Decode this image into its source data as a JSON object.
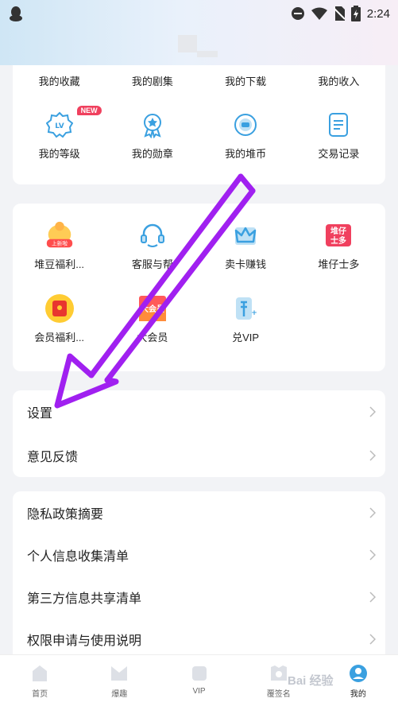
{
  "status_bar": {
    "time": "2:24"
  },
  "top_grid": {
    "row1": [
      "我的收藏",
      "我的剧集",
      "我的下载",
      "我的收入"
    ],
    "row2": [
      {
        "label": "我的等级",
        "icon": "level-icon",
        "badge": "NEW"
      },
      {
        "label": "我的勋章",
        "icon": "medal-icon"
      },
      {
        "label": "我的堆币",
        "icon": "coin-icon"
      },
      {
        "label": "交易记录",
        "icon": "record-icon"
      }
    ]
  },
  "services": {
    "row1": [
      {
        "label": "堆豆福利...",
        "icon": "gift-bag-icon",
        "icon_text": "上新啦"
      },
      {
        "label": "客服与帮",
        "icon": "headset-icon"
      },
      {
        "label": "卖卡赚钱",
        "icon": "crown-card-icon"
      },
      {
        "label": "堆仔士多",
        "icon": "store-icon",
        "icon_text": "堆仔士多"
      }
    ],
    "row2": [
      {
        "label": "会员福利...",
        "icon": "red-envelope-icon"
      },
      {
        "label": "大会员",
        "icon": "big-member-icon",
        "icon_text": "大会员"
      },
      {
        "label": "兑VIP",
        "icon": "vip-exchange-icon"
      }
    ]
  },
  "settings": [
    "设置",
    "意见反馈"
  ],
  "privacy": [
    "隐私政策摘要",
    "个人信息收集清单",
    "第三方信息共享清单",
    "权限申请与使用说明"
  ],
  "tabs": [
    {
      "label": "首页",
      "icon": "home-icon"
    },
    {
      "label": "爆趣",
      "icon": "explore-icon"
    },
    {
      "label": "VIP",
      "icon": "vip-icon"
    },
    {
      "label": "覆签名",
      "icon": "sign-icon"
    },
    {
      "label": "我的",
      "icon": "profile-icon",
      "active": true
    }
  ],
  "watermark": "Bai 经验",
  "colors": {
    "accent_purple": "#a020f0",
    "badge_red": "#f0405e",
    "icon_blue": "#3aa0e0"
  }
}
